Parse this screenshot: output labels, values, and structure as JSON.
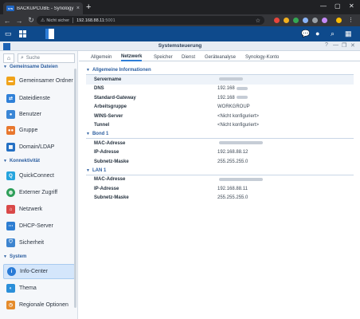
{
  "browser": {
    "tab_title": "BACKUPCUBE - Synology DiskS",
    "tab_close": "×",
    "new_tab": "+",
    "omnibox": {
      "security_label": "Nicht sicher",
      "url": "192.168.88.11",
      "url_port": ":5001"
    },
    "icons": [
      "back-icon",
      "forward-icon",
      "reload-icon",
      "star-icon",
      "minimize-icon",
      "maximize-icon",
      "close-icon"
    ]
  },
  "dsm": {
    "icons": [
      "apps-grid-icon",
      "chat-icon",
      "user-icon",
      "search-icon",
      "widgets-icon"
    ]
  },
  "window": {
    "title": "Systemsteuerung",
    "controls": [
      "?",
      "—",
      "❐",
      "✕"
    ]
  },
  "sidebar": {
    "search_placeholder": "Suche",
    "sections": [
      {
        "label": "Gemeinsame Dateien"
      },
      {
        "label": "Konnektivität"
      },
      {
        "label": "System"
      }
    ],
    "items": [
      {
        "label": "Gemeinsamer Ordner",
        "icon": "folder-icon",
        "color": "#f0a31a"
      },
      {
        "label": "Dateidienste",
        "icon": "file-services-icon",
        "color": "#2f80d8"
      },
      {
        "label": "Benutzer",
        "icon": "user-icon",
        "color": "#3a86d6"
      },
      {
        "label": "Gruppe",
        "icon": "group-icon",
        "color": "#e8772e"
      },
      {
        "label": "Domain/LDAP",
        "icon": "domain-icon",
        "color": "#2470c4"
      },
      {
        "label": "QuickConnect",
        "icon": "quickconnect-icon",
        "color": "#25a4de"
      },
      {
        "label": "Externer Zugriff",
        "icon": "globe-icon",
        "color": "#2f9f5a"
      },
      {
        "label": "Netzwerk",
        "icon": "network-icon",
        "color": "#d94848"
      },
      {
        "label": "DHCP-Server",
        "icon": "dhcp-icon",
        "color": "#2d7dd2"
      },
      {
        "label": "Sicherheit",
        "icon": "shield-icon",
        "color": "#3d84cf"
      },
      {
        "label": "Info-Center",
        "icon": "info-icon",
        "color": "#2a7bd6"
      },
      {
        "label": "Thema",
        "icon": "theme-icon",
        "color": "#2b8fd9"
      },
      {
        "label": "Regionale Optionen",
        "icon": "region-icon",
        "color": "#e58b2b"
      }
    ]
  },
  "tabs": [
    "Allgemein",
    "Netzwerk",
    "Speicher",
    "Dienst",
    "Geräteanalyse",
    "Synology-Konto"
  ],
  "info": {
    "general": {
      "heading": "Allgemeine Informationen",
      "rows": [
        {
          "key": "Servername",
          "value": ""
        },
        {
          "key": "DNS",
          "value": "192.168"
        },
        {
          "key": "Standard-Gateway",
          "value": "192.168"
        },
        {
          "key": "Arbeitsgruppe",
          "value": "WORKGROUP"
        },
        {
          "key": "WINS-Server",
          "value": "<Nicht konfiguriert>"
        },
        {
          "key": "Tunnel",
          "value": "<Nicht konfiguriert>"
        }
      ]
    },
    "bond1": {
      "heading": "Bond 1",
      "rows": [
        {
          "key": "MAC-Adresse",
          "value": ""
        },
        {
          "key": "IP-Adresse",
          "value": "192.168.88.12"
        },
        {
          "key": "Subnetz-Maske",
          "value": "255.255.255.0"
        }
      ]
    },
    "lan1": {
      "heading": "LAN 1",
      "rows": [
        {
          "key": "MAC-Adresse",
          "value": ""
        },
        {
          "key": "IP-Adresse",
          "value": "192.168.88.11"
        },
        {
          "key": "Subnetz-Maske",
          "value": "255.255.255.0"
        }
      ]
    }
  }
}
